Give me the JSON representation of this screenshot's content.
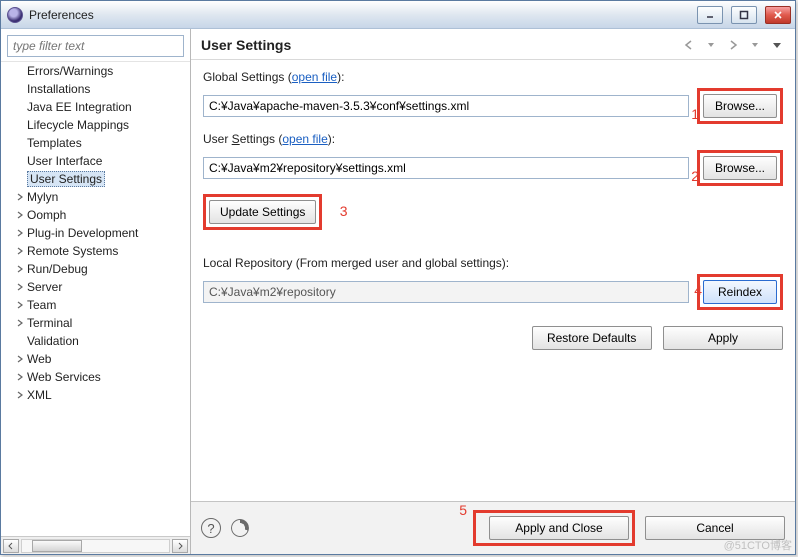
{
  "window": {
    "title": "Preferences"
  },
  "filter": {
    "placeholder": "type filter text"
  },
  "tree": {
    "sub_items": [
      "Errors/Warnings",
      "Installations",
      "Java EE Integration",
      "Lifecycle Mappings",
      "Templates",
      "User Interface",
      "User Settings"
    ],
    "top_items": [
      "Mylyn",
      "Oomph",
      "Plug-in Development",
      "Remote Systems",
      "Run/Debug",
      "Server",
      "Team",
      "Terminal",
      "Validation",
      "Web",
      "Web Services",
      "XML"
    ],
    "selected": "User Settings"
  },
  "page": {
    "heading": "User Settings",
    "global_label_prefix": "Global Settings (",
    "open_file": "open file",
    "label_suffix": "):",
    "global_value": "C:¥Java¥apache-maven-3.5.3¥conf¥settings.xml",
    "browse": "Browse...",
    "user_label_a": "User ",
    "user_label_b_u": "S",
    "user_label_c": "ettings (",
    "user_value": "C:¥Java¥m2¥repository¥settings.xml",
    "update_btn": "Update Settings",
    "local_repo_label": "Local Repository (From merged user and global settings):",
    "local_repo_value": "C:¥Java¥m2¥repository",
    "reindex": "Reindex",
    "restore": "Restore Defaults",
    "apply": "Apply",
    "apply_close": "Apply and Close",
    "cancel": "Cancel"
  },
  "annotations": {
    "a1": "1",
    "a2": "2",
    "a3": "3",
    "a4": "4",
    "a5": "5"
  },
  "watermark": "@51CTO博客"
}
